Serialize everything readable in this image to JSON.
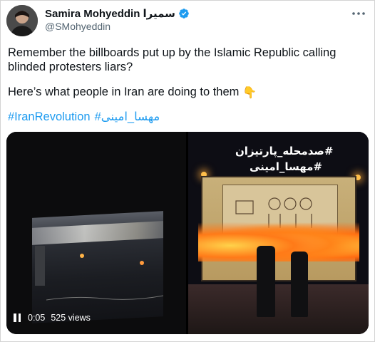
{
  "author": {
    "display_name": "Samira Mohyeddin سميرا",
    "handle": "@SMohyeddin",
    "verified": true,
    "avatar_icon": "avatar-photo"
  },
  "more_icon": "more-options-icon",
  "tweet": {
    "line1": "Remember the billboards put up by the Islamic Republic calling blinded protesters liars?",
    "line2": "Here’s what people in Iran are doing to them",
    "emoji": "👇",
    "hashtags": [
      "#IranRevolution",
      "#مهسا_امینی"
    ]
  },
  "media": {
    "video": {
      "state_icon": "pause-icon",
      "time": "0:05",
      "views": "525 views"
    },
    "photo": {
      "hashtag_top": "#صدمحله_پارتیزان",
      "hashtag_bottom": "#مهسا_امینی"
    }
  },
  "colors": {
    "link": "#1d9bf0",
    "secondary_text": "#536471",
    "verified_badge": "#1d9bf0"
  }
}
